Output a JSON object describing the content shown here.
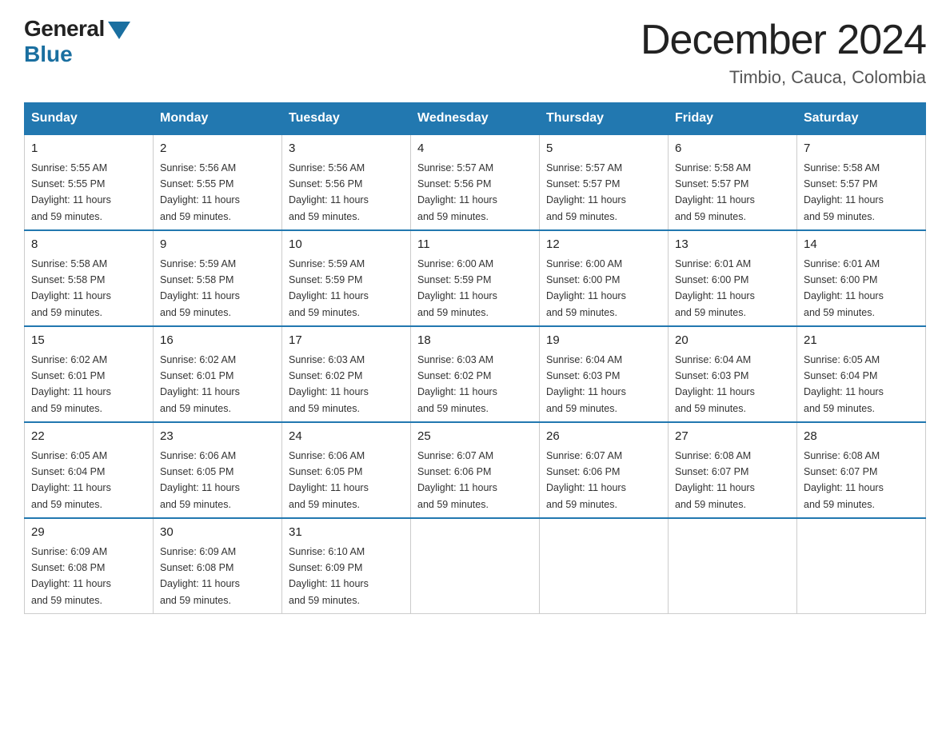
{
  "header": {
    "logo_general": "General",
    "logo_blue": "Blue",
    "month_title": "December 2024",
    "location": "Timbio, Cauca, Colombia"
  },
  "days_of_week": [
    "Sunday",
    "Monday",
    "Tuesday",
    "Wednesday",
    "Thursday",
    "Friday",
    "Saturday"
  ],
  "weeks": [
    [
      {
        "date": "1",
        "sunrise": "5:55 AM",
        "sunset": "5:55 PM",
        "daylight": "11 hours and 59 minutes."
      },
      {
        "date": "2",
        "sunrise": "5:56 AM",
        "sunset": "5:55 PM",
        "daylight": "11 hours and 59 minutes."
      },
      {
        "date": "3",
        "sunrise": "5:56 AM",
        "sunset": "5:56 PM",
        "daylight": "11 hours and 59 minutes."
      },
      {
        "date": "4",
        "sunrise": "5:57 AM",
        "sunset": "5:56 PM",
        "daylight": "11 hours and 59 minutes."
      },
      {
        "date": "5",
        "sunrise": "5:57 AM",
        "sunset": "5:57 PM",
        "daylight": "11 hours and 59 minutes."
      },
      {
        "date": "6",
        "sunrise": "5:58 AM",
        "sunset": "5:57 PM",
        "daylight": "11 hours and 59 minutes."
      },
      {
        "date": "7",
        "sunrise": "5:58 AM",
        "sunset": "5:57 PM",
        "daylight": "11 hours and 59 minutes."
      }
    ],
    [
      {
        "date": "8",
        "sunrise": "5:58 AM",
        "sunset": "5:58 PM",
        "daylight": "11 hours and 59 minutes."
      },
      {
        "date": "9",
        "sunrise": "5:59 AM",
        "sunset": "5:58 PM",
        "daylight": "11 hours and 59 minutes."
      },
      {
        "date": "10",
        "sunrise": "5:59 AM",
        "sunset": "5:59 PM",
        "daylight": "11 hours and 59 minutes."
      },
      {
        "date": "11",
        "sunrise": "6:00 AM",
        "sunset": "5:59 PM",
        "daylight": "11 hours and 59 minutes."
      },
      {
        "date": "12",
        "sunrise": "6:00 AM",
        "sunset": "6:00 PM",
        "daylight": "11 hours and 59 minutes."
      },
      {
        "date": "13",
        "sunrise": "6:01 AM",
        "sunset": "6:00 PM",
        "daylight": "11 hours and 59 minutes."
      },
      {
        "date": "14",
        "sunrise": "6:01 AM",
        "sunset": "6:00 PM",
        "daylight": "11 hours and 59 minutes."
      }
    ],
    [
      {
        "date": "15",
        "sunrise": "6:02 AM",
        "sunset": "6:01 PM",
        "daylight": "11 hours and 59 minutes."
      },
      {
        "date": "16",
        "sunrise": "6:02 AM",
        "sunset": "6:01 PM",
        "daylight": "11 hours and 59 minutes."
      },
      {
        "date": "17",
        "sunrise": "6:03 AM",
        "sunset": "6:02 PM",
        "daylight": "11 hours and 59 minutes."
      },
      {
        "date": "18",
        "sunrise": "6:03 AM",
        "sunset": "6:02 PM",
        "daylight": "11 hours and 59 minutes."
      },
      {
        "date": "19",
        "sunrise": "6:04 AM",
        "sunset": "6:03 PM",
        "daylight": "11 hours and 59 minutes."
      },
      {
        "date": "20",
        "sunrise": "6:04 AM",
        "sunset": "6:03 PM",
        "daylight": "11 hours and 59 minutes."
      },
      {
        "date": "21",
        "sunrise": "6:05 AM",
        "sunset": "6:04 PM",
        "daylight": "11 hours and 59 minutes."
      }
    ],
    [
      {
        "date": "22",
        "sunrise": "6:05 AM",
        "sunset": "6:04 PM",
        "daylight": "11 hours and 59 minutes."
      },
      {
        "date": "23",
        "sunrise": "6:06 AM",
        "sunset": "6:05 PM",
        "daylight": "11 hours and 59 minutes."
      },
      {
        "date": "24",
        "sunrise": "6:06 AM",
        "sunset": "6:05 PM",
        "daylight": "11 hours and 59 minutes."
      },
      {
        "date": "25",
        "sunrise": "6:07 AM",
        "sunset": "6:06 PM",
        "daylight": "11 hours and 59 minutes."
      },
      {
        "date": "26",
        "sunrise": "6:07 AM",
        "sunset": "6:06 PM",
        "daylight": "11 hours and 59 minutes."
      },
      {
        "date": "27",
        "sunrise": "6:08 AM",
        "sunset": "6:07 PM",
        "daylight": "11 hours and 59 minutes."
      },
      {
        "date": "28",
        "sunrise": "6:08 AM",
        "sunset": "6:07 PM",
        "daylight": "11 hours and 59 minutes."
      }
    ],
    [
      {
        "date": "29",
        "sunrise": "6:09 AM",
        "sunset": "6:08 PM",
        "daylight": "11 hours and 59 minutes."
      },
      {
        "date": "30",
        "sunrise": "6:09 AM",
        "sunset": "6:08 PM",
        "daylight": "11 hours and 59 minutes."
      },
      {
        "date": "31",
        "sunrise": "6:10 AM",
        "sunset": "6:09 PM",
        "daylight": "11 hours and 59 minutes."
      },
      {
        "date": "",
        "sunrise": "",
        "sunset": "",
        "daylight": ""
      },
      {
        "date": "",
        "sunrise": "",
        "sunset": "",
        "daylight": ""
      },
      {
        "date": "",
        "sunrise": "",
        "sunset": "",
        "daylight": ""
      },
      {
        "date": "",
        "sunrise": "",
        "sunset": "",
        "daylight": ""
      }
    ]
  ]
}
